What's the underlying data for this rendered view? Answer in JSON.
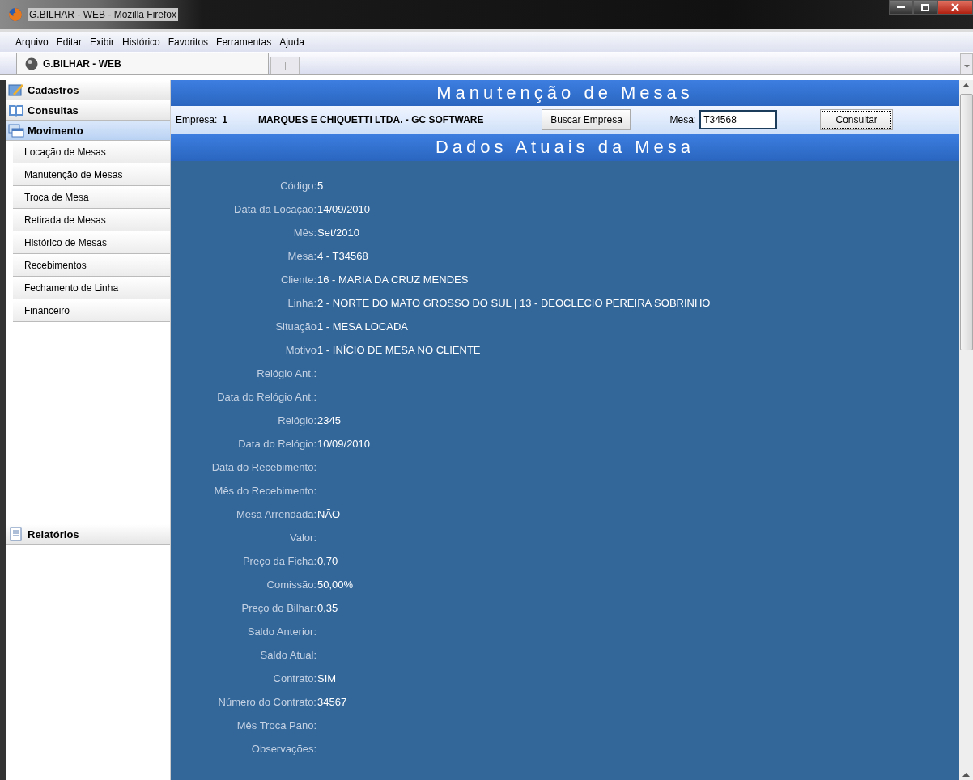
{
  "window": {
    "title": "G.BILHAR - WEB - Mozilla Firefox"
  },
  "menu": [
    "Arquivo",
    "Editar",
    "Exibir",
    "Histórico",
    "Favoritos",
    "Ferramentas",
    "Ajuda"
  ],
  "tabs": [
    {
      "label": "G.BILHAR - WEB",
      "selected": true
    }
  ],
  "sidebar": {
    "sections": [
      {
        "label": "Cadastros",
        "selected": false
      },
      {
        "label": "Consultas",
        "selected": false
      },
      {
        "label": "Movimento",
        "selected": true,
        "items": [
          "Locação de Mesas",
          "Manutenção de Mesas",
          "Troca de Mesa",
          "Retirada de Mesas",
          "Histórico de Mesas",
          "Recebimentos",
          "Fechamento de Linha",
          "Financeiro"
        ]
      },
      {
        "label": "Relatórios",
        "selected": false
      }
    ]
  },
  "page_title": "Manutenção de Mesas",
  "company_bar": {
    "label": "Empresa:",
    "number": "1",
    "name": "MARQUES E CHIQUETTI LTDA. - GC SOFTWARE",
    "search_button": "Buscar Empresa",
    "mesa_label": "Mesa:",
    "mesa_value": "T34568",
    "submit_button": "Consultar"
  },
  "section_title": "Dados Atuais da Mesa",
  "fields": [
    {
      "label": "Código:",
      "value": "5"
    },
    {
      "label": "Data da Locação:",
      "value": "14/09/2010"
    },
    {
      "label": "Mês:",
      "value": "Set/2010"
    },
    {
      "label": "Mesa:",
      "value": "4 - T34568"
    },
    {
      "label": "Cliente:",
      "value": "16 - MARIA DA CRUZ MENDES"
    },
    {
      "label": "Linha:",
      "value": "2 - NORTE DO MATO GROSSO DO SUL | 13 - DEOCLECIO PEREIRA SOBRINHO"
    },
    {
      "label": "Situação",
      "value": "1 - MESA LOCADA"
    },
    {
      "label": "Motivo",
      "value": "1 - INÍCIO DE MESA NO CLIENTE"
    },
    {
      "label": "Relógio Ant.:"
    },
    {
      "label": "Data do Relógio Ant.:"
    },
    {
      "label": "Relógio:",
      "value": "2345"
    },
    {
      "label": "Data do Relógio:",
      "value": "10/09/2010"
    },
    {
      "label": "Data do Recebimento:"
    },
    {
      "label": "Mês do Recebimento:"
    },
    {
      "label": "Mesa Arrendada:",
      "value": "NÃO"
    },
    {
      "label": "Valor:"
    },
    {
      "label": "Preço da Ficha:",
      "value": "0,70"
    },
    {
      "label": "Comissão:",
      "value": "50,00%"
    },
    {
      "label": "Preço do Bilhar:",
      "value": "0,35"
    },
    {
      "label": "Saldo Anterior:"
    },
    {
      "label": "Saldo Atual:"
    },
    {
      "label": "Contrato:",
      "value": "SIM"
    },
    {
      "label": "Número do Contrato:",
      "value": "34567"
    },
    {
      "label": "Mês Troca Pano:"
    },
    {
      "label": "Observações:"
    }
  ]
}
